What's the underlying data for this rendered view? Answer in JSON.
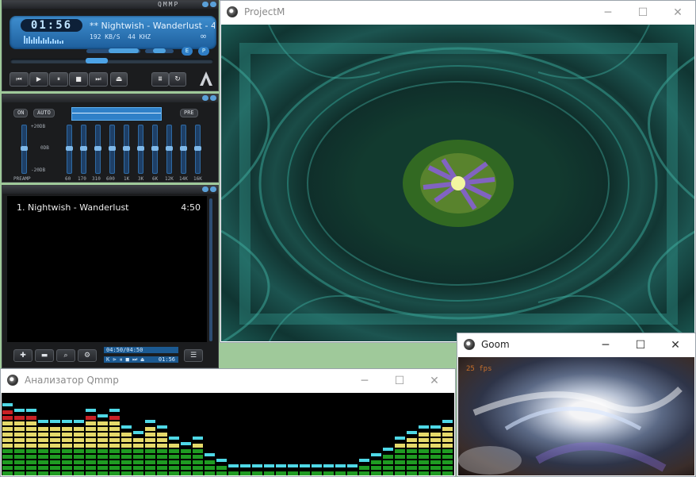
{
  "qmmp": {
    "skin_title": "QMMP",
    "time": "01:56",
    "song_title": "** Nightwish - Wanderlust - 4:5",
    "bitrate": "192 KB/S",
    "samplerate": "44 KHZ",
    "infinity": "∞",
    "transport": [
      "⏮",
      "▶",
      "⏸",
      "■",
      "⏭"
    ],
    "eject": "⏏",
    "eq": {
      "on": "ON",
      "auto": "AUTO",
      "presets": "PRE",
      "db_top": "+20DB",
      "db_mid": "0DB",
      "db_bot": "-20DB",
      "preamp": "PREAMP",
      "bands": [
        "60",
        "170",
        "310",
        "600",
        "1K",
        "3K",
        "6K",
        "12K",
        "14K",
        "16K"
      ]
    },
    "playlist": {
      "items": [
        {
          "title": "1. Nightwish - Wanderlust",
          "duration": "4:50"
        }
      ],
      "total_time": "04:50/04:50",
      "controls": "K ⊳ ⏸ ■ ⏭ ⏏",
      "current_time": "01:56"
    }
  },
  "projectm": {
    "title": "ProjectM"
  },
  "analyzer": {
    "title": "Анализатор Qmmp"
  },
  "goom": {
    "title": "Goom",
    "fps": "25 fps"
  },
  "window_buttons": {
    "minimize": "─",
    "maximize": "☐",
    "close": "✕"
  },
  "chart_data": {
    "type": "bar",
    "title": "",
    "bands": 64,
    "levels_segments": [
      12,
      11,
      11,
      9,
      9,
      9,
      9,
      11,
      10,
      11,
      8,
      7,
      9,
      8,
      6,
      5,
      6,
      3,
      2,
      1,
      1,
      1,
      1,
      1,
      1,
      1,
      1,
      1,
      1,
      1,
      2,
      3,
      4,
      6,
      7,
      8,
      8,
      9,
      11,
      12,
      11,
      11,
      12,
      10,
      9,
      9,
      11,
      12,
      12,
      12,
      13,
      13,
      13,
      13,
      13,
      13,
      13,
      13,
      13,
      13,
      13,
      13,
      13,
      13
    ],
    "colors": {
      "low": "#1f9b22",
      "mid": "#e5d96a",
      "high": "#c92125",
      "peak": "#4fd8e6"
    }
  }
}
